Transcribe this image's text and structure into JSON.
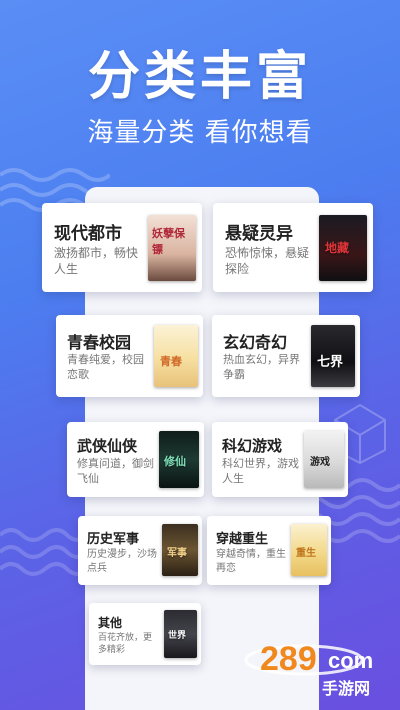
{
  "hero": {
    "headline": "分类丰富",
    "subline": "海量分类 看你想看"
  },
  "categories": [
    {
      "title": "现代都市",
      "desc": "激扬都市，畅快人生",
      "cover_text": "妖孽保镖"
    },
    {
      "title": "悬疑灵异",
      "desc": "恐怖惊悚，悬疑探险",
      "cover_text": "地藏"
    },
    {
      "title": "青春校园",
      "desc": "青春纯爱，校园恋歌",
      "cover_text": "青春"
    },
    {
      "title": "玄幻奇幻",
      "desc": "热血玄幻，异界争霸",
      "cover_text": "七界"
    },
    {
      "title": "武侠仙侠",
      "desc": "修真问道，御剑飞仙",
      "cover_text": "修仙"
    },
    {
      "title": "科幻游戏",
      "desc": "科幻世界，游戏人生",
      "cover_text": "游戏"
    },
    {
      "title": "历史军事",
      "desc": "历史漫步，沙场点兵",
      "cover_text": "军事"
    },
    {
      "title": "穿越重生",
      "desc": "穿越奇情，重生再恋",
      "cover_text": "重生"
    },
    {
      "title": "其他",
      "desc": "百花齐放，更多精彩",
      "cover_text": "世界"
    }
  ],
  "watermark": {
    "number": "289",
    "suffix": "com",
    "text": "手游网"
  },
  "colors": {
    "bg_top": "#5a8ef5",
    "bg_bottom": "#6a4fe0",
    "panel": "#f4f5fa",
    "brand_orange": "#f0881e"
  }
}
